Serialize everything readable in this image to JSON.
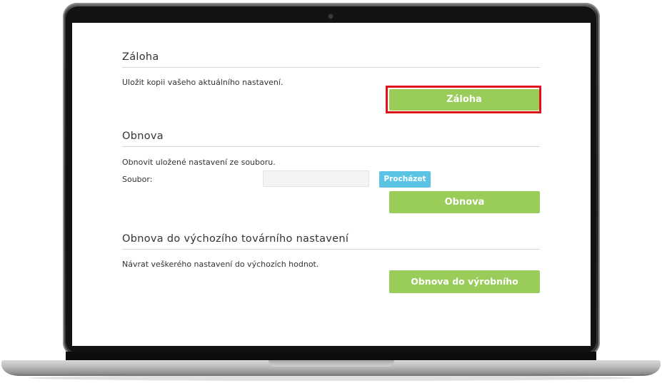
{
  "backup": {
    "title": "Záloha",
    "description": "Uložit kopii vašeho aktuálního nastavení.",
    "button_label": "Záloha"
  },
  "restore": {
    "title": "Obnova",
    "description": "Obnovit uložené nastavení ze souboru.",
    "file_label": "Soubor:",
    "file_value": "",
    "browse_label": "Procházet",
    "button_label": "Obnova"
  },
  "factory": {
    "title": "Obnova do výchozího továrního nastavení",
    "description": "Návrat veškerého nastavení do výchozích hodnot.",
    "button_label": "Obnova do výrobního nastavení"
  },
  "colors": {
    "primary_button": "#99cc59",
    "browse_button": "#5bc4e5",
    "highlight_border": "#e0121b"
  }
}
